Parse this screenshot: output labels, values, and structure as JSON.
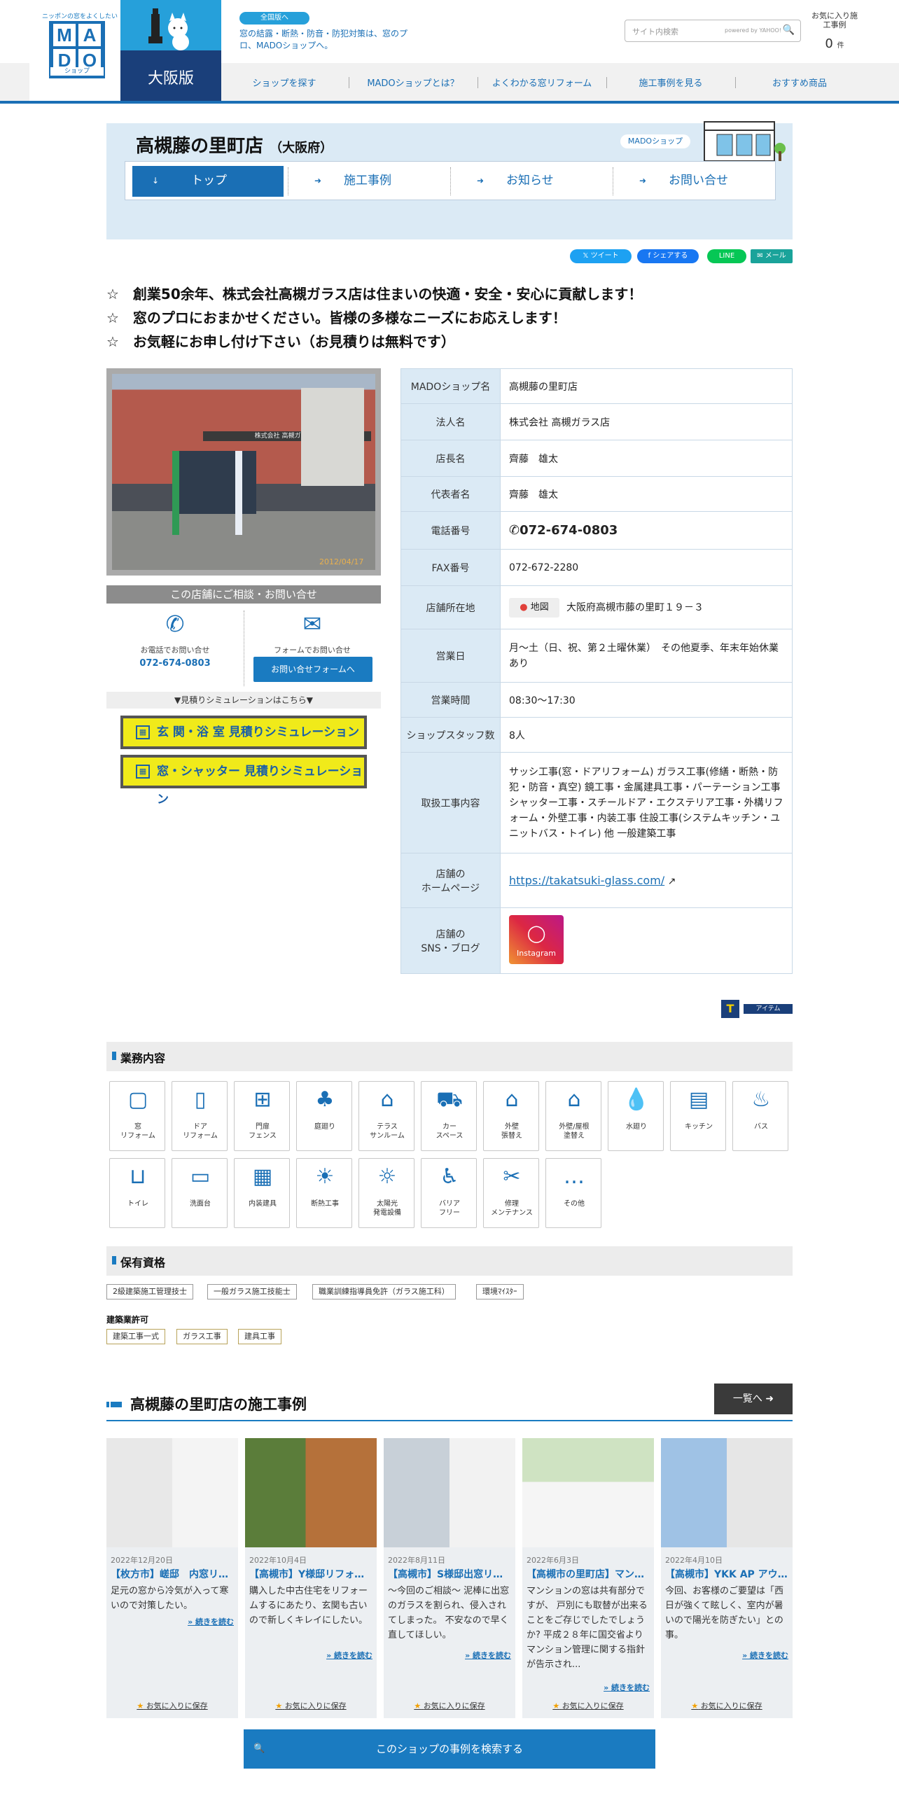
{
  "header": {
    "logo_tagline": "ニッポンの窓をよくしたい",
    "logo_letters": [
      "M",
      "A",
      "D",
      "O"
    ],
    "logo_sub": "ショップ",
    "region": "大阪版",
    "national_btn": "全国版へ",
    "tagline": "窓の結露・断熱・防音・防犯対策は、窓のプロ、MADOショップへ。",
    "search_placeholder": "サイト内検索",
    "search_powered": "powered by YAHOO!",
    "favorites_label": "お気に入り施工事例",
    "favorites_count": "0",
    "favorites_unit": "件",
    "nav": [
      "ショップを探す",
      "MADOショップとは？",
      "よくわかる窓リフォーム",
      "施工事例を見る",
      "おすすめ商品"
    ]
  },
  "store": {
    "name": "高槻藤の里町店",
    "pref": "（大阪府）",
    "badge": "MADOショップ",
    "tabs": [
      "トップ",
      "施工事例",
      "お知らせ",
      "お問い合せ"
    ]
  },
  "social": {
    "tweet": "ツイート",
    "share": "シェアする",
    "line": "LINE",
    "mail": "メール"
  },
  "intro": [
    "☆　創業50余年、株式会社高槻ガラス店は住まいの快適・安全・安心に貢献します！",
    "☆　窓のプロにおまかせください。皆様の多様なニーズにお応えします！",
    "☆　お気軽にお申し付け下さい（お見積りは無料です）"
  ],
  "photo": {
    "date": "2012/04/17",
    "sign": "株式会社 高槻ガラス店"
  },
  "contact": {
    "title": "この店舗にご相談・お問い合せ",
    "phone_label": "お電話でお問い合せ",
    "phone": "072-674-0803",
    "form_label": "フォームでお問い合せ",
    "form_btn": "お問い合せフォームへ",
    "sim_title": "▼見積りシミュレーションはこちら▼",
    "sim1": "玄 関・浴 室 見積りシミュレーション",
    "sim2": "窓・シャッター 見積りシミュレーション"
  },
  "info": [
    {
      "k": "MADOショップ名",
      "v": "高槻藤の里町店"
    },
    {
      "k": "法人名",
      "v": "株式会社 高槻ガラス店"
    },
    {
      "k": "店長名",
      "v": "齊藤　雄太"
    },
    {
      "k": "代表者名",
      "v": "齊藤　雄太"
    },
    {
      "k": "電話番号",
      "v": "072-674-0803"
    },
    {
      "k": "FAX番号",
      "v": "072-672-2280"
    },
    {
      "k": "店舗所在地",
      "v": "大阪府高槻市藤の里町１９－３",
      "map": "地図"
    },
    {
      "k": "営業日",
      "v": "月～土（日、祝、第２土曜休業）　その他夏季、年末年始休業あり"
    },
    {
      "k": "営業時間",
      "v": "08:30～17:30"
    },
    {
      "k": "ショップスタッフ数",
      "v": "8人"
    },
    {
      "k": "取扱工事内容",
      "v": "サッシ工事(窓・ドアリフォーム) ガラス工事(修繕・断熱・防犯・防音・真空) 鏡工事・金属建具工事・パーテーション工事 シャッター工事・スチールドア・エクステリア工事・外構リフォーム・外壁工事・内装工事 住設工事(システムキッチン・ユニットバス・トイレ) 他 一般建築工事"
    },
    {
      "k": "店舗の\nホームページ",
      "v": "https://takatsuki-glass.com/"
    },
    {
      "k": "店舗の\nSNS・ブログ",
      "v": "Instagram"
    }
  ],
  "titem": "アイテム",
  "business": {
    "title": "業務内容",
    "items": [
      {
        "label": "窓\nリフォーム",
        "icon": "window-icon"
      },
      {
        "label": "ドア\nリフォーム",
        "icon": "door-icon"
      },
      {
        "label": "門扉\nフェンス",
        "icon": "gate-icon"
      },
      {
        "label": "庭廻り",
        "icon": "garden-icon"
      },
      {
        "label": "テラス\nサンルーム",
        "icon": "terrace-icon"
      },
      {
        "label": "カー\nスペース",
        "icon": "car-icon"
      },
      {
        "label": "外壁\n張替え",
        "icon": "wall-icon"
      },
      {
        "label": "外壁/屋根\n塗替え",
        "icon": "roof-icon"
      },
      {
        "label": "水廻り",
        "icon": "water-icon"
      },
      {
        "label": "キッチン",
        "icon": "kitchen-icon"
      },
      {
        "label": "バス",
        "icon": "bath-icon"
      },
      {
        "label": "トイレ",
        "icon": "toilet-icon"
      },
      {
        "label": "洗面台",
        "icon": "washstand-icon"
      },
      {
        "label": "内装建具",
        "icon": "interior-icon"
      },
      {
        "label": "断熱工事",
        "icon": "insulation-icon"
      },
      {
        "label": "太陽光\n発電設備",
        "icon": "solar-icon"
      },
      {
        "label": "バリア\nフリー",
        "icon": "barrier-free-icon"
      },
      {
        "label": "修理\nメンテナンス",
        "icon": "repair-icon"
      },
      {
        "label": "その他",
        "icon": "etc-icon"
      }
    ]
  },
  "quals": {
    "title": "保有資格",
    "items": [
      "2級建築施工管理技士",
      "一般ガラス施工技能士",
      "職業訓練指導員免許（ガラス施工科）",
      "環境ﾏｲｽﾀｰ"
    ],
    "license_title": "建築業許可",
    "licenses": [
      "建築工事一式",
      "ガラス工事",
      "建具工事"
    ]
  },
  "works": {
    "title": "高槻藤の里町店の施工事例",
    "list_btn": "一覧へ",
    "more": "続きを読む",
    "fav": "お気に入りに保存",
    "search_btn": "このショップの事例を検索する",
    "cards": [
      {
        "date": "2022年12月20日",
        "title": "【枚方市】嵯邸　内窓リフォーム",
        "body": "足元の窓から冷気が入って寒いので対策したい。"
      },
      {
        "date": "2022年10月4日",
        "title": "【高槻市】Y様邸リフォーム",
        "body": "購入した中古住宅をリフォームするにあたり、玄関も古いので新しくキレイにしたい。"
      },
      {
        "date": "2022年8月11日",
        "title": "【高槻市】S様邸出窓リフォーム",
        "body": "～今回のご相談～ 泥棒に出窓のガラスを割られ、侵入されてしまった。 不安なので早く直してほしい。"
      },
      {
        "date": "2022年6月3日",
        "title": "【高槻市の里町店】マンション窓",
        "body": "マンションの窓は共有部分ですが、 戸別にも取替が出来ることをご存じでしたでしょうか? 平成２８年に国交省よりマンション管理に関する指針が告示され..."
      },
      {
        "date": "2022年4月10日",
        "title": "【高槻市】YKK AP アウターシェード",
        "body": "今回、お客様のご要望は「西日が強くて眩しく、室内が暑いので陽光を防ぎたい」との事。"
      }
    ]
  }
}
